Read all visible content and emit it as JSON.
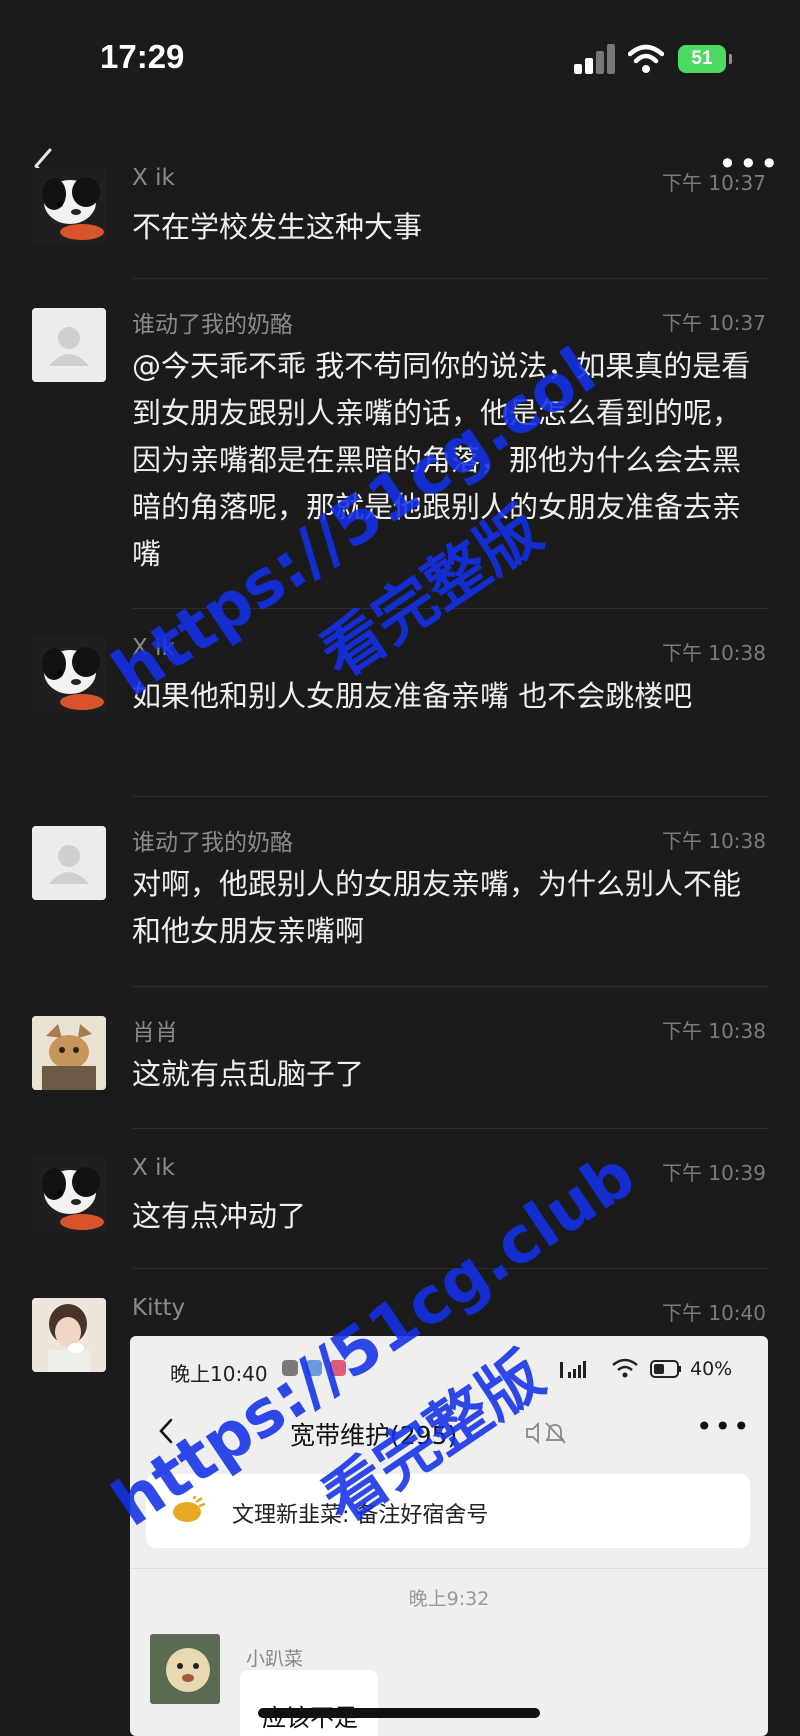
{
  "status_bar": {
    "time": "17:29",
    "battery": "51"
  },
  "messages": [
    {
      "name": "X ik",
      "time": "下午 10:37",
      "text": "不在学校发生这种大事"
    },
    {
      "name": "谁动了我的奶酪",
      "time": "下午 10:37",
      "text": "@今天乖不乖 我不苟同你的说法，如果真的是看到女朋友跟别人亲嘴的话，他是怎么看到的呢，因为亲嘴都是在黑暗的角落，那他为什么会去黑暗的角落呢，那就是他跟别人的女朋友准备去亲嘴"
    },
    {
      "name": "X ik",
      "time": "下午 10:38",
      "text": "如果他和别人女朋友准备亲嘴 也不会跳楼吧"
    },
    {
      "name": "谁动了我的奶酪",
      "time": "下午 10:38",
      "text": "对啊，他跟别人的女朋友亲嘴，为什么别人不能和他女朋友亲嘴啊"
    },
    {
      "name": "肖肖",
      "time": "下午 10:38",
      "text": "这就有点乱脑子了"
    },
    {
      "name": "X ik",
      "time": "下午 10:39",
      "text": "这有点冲动了"
    },
    {
      "name": "Kitty",
      "time": "下午 10:40"
    }
  ],
  "embedded_screenshot": {
    "time": "晚上10:40",
    "battery": "40%",
    "title": "宽带维护(295)",
    "notice": "文理新韭菜: 备注好宿舍号",
    "center_time": "晚上9:32",
    "sender": "小趴菜",
    "bubble_text": "应该不是"
  },
  "watermarks": {
    "upper_url": "https://51cg.col",
    "upper_cn": "看完整版",
    "lower_url": "https://51cg.club",
    "lower_cn": "看完整版"
  }
}
